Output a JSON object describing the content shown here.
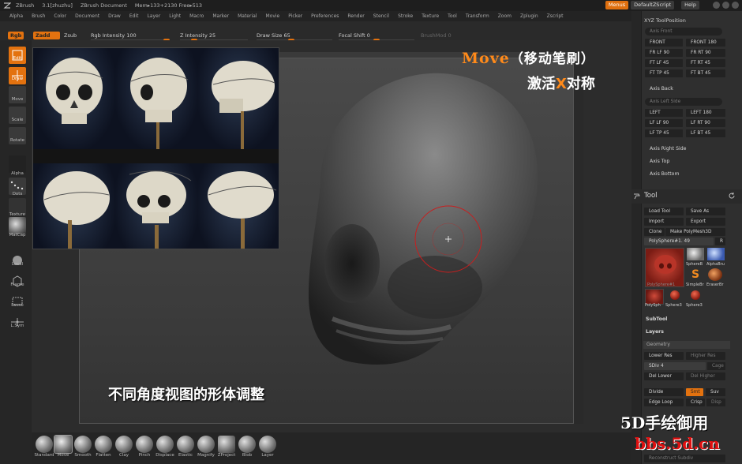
{
  "titlebar": {
    "app": "ZBrush",
    "version": "3.1[zhuzhu]",
    "doc": "ZBrush Document",
    "mem": "Mem▸133+2130 Free▸513",
    "menus_btn": "Menus",
    "script_btn": "DefaultZScript",
    "help_btn": "Help"
  },
  "menubar": [
    "Alpha",
    "Brush",
    "Color",
    "Document",
    "Draw",
    "Edit",
    "Layer",
    "Light",
    "Macro",
    "Marker",
    "Material",
    "Movie",
    "Picker",
    "Preferences",
    "Render",
    "Stencil",
    "Stroke",
    "Texture",
    "Tool",
    "Transform",
    "Zoom",
    "Zplugin",
    "Zscript"
  ],
  "toolbar": {
    "rgb": "Rgb",
    "zadd": "Zadd",
    "zsub": "Zsub",
    "rgb_intensity": "Rgb Intensity 100",
    "z_intensity": "Z Intensity 25",
    "draw_size": "Draw Size 65",
    "focal_shift": "Focal Shift 0",
    "brushmod": "BrushMod 0"
  },
  "left_tools": [
    "Edit",
    "Draw",
    "Move",
    "Scale",
    "Rotate",
    "Alpha",
    "Dots",
    "Texture",
    "MatCap",
    "Local",
    "Frame",
    "Lasso",
    "L.Sym"
  ],
  "overlay": {
    "move_title": "Move",
    "move_cn": "（移动笔刷）",
    "sym_pre": "激活",
    "sym_x": "X",
    "sym_post": "对称",
    "caption": "不同角度视图的形体调整"
  },
  "brushes": [
    "Standard",
    "Move",
    "Smooth",
    "Flatten",
    "Clay",
    "Pinch",
    "Displace",
    "Elastic",
    "Magnify",
    "ZProject",
    "Blob",
    "Layer"
  ],
  "xyz": {
    "header": "XYZ ToolPosition",
    "axis_front": "Axis Front",
    "front": "FRONT",
    "front180": "FRONT 180",
    "fr_lf90": "FR LF 90",
    "fr_rt90": "FR RT 90",
    "ft_lf45": "FT LF 45",
    "ft_rt45": "FT RT 45",
    "ft_tp45": "FT TP 45",
    "ft_bt45": "FT BT 45",
    "axis_back": "Axis Back",
    "axis_left_side": "Axis Left Side",
    "left": "LEFT",
    "left180": "LEFT 180",
    "lf_lf90": "LF LF 90",
    "lf_rt90": "LF RT 90",
    "lf_tp45": "LF TP 45",
    "lf_bt45": "LF BT 45",
    "axis_right_side": "Axis Right Side",
    "axis_top": "Axis Top",
    "axis_bottom": "Axis Bottom"
  },
  "tool": {
    "title": "Tool",
    "load_tool": "Load Tool",
    "save_as": "Save As",
    "import": "Import",
    "export": "Export",
    "clone": "Clone",
    "make_polymesh": "Make PolyMesh3D",
    "current": "PolySphere#1. 49",
    "r": "R",
    "thumbs": [
      "PolySphere#1",
      "SphereB",
      "AlphaBru",
      "SimpleBr",
      "EraserBr",
      "PolySph",
      "Sphere3",
      "Sphere3"
    ],
    "subtool": "SubTool",
    "layers": "Layers",
    "geometry": "Geometry",
    "lower_res": "Lower Res",
    "higher_res": "Higher Res",
    "sdiv": "SDiv 4",
    "cage": "Cage",
    "del_lower": "Del Lower",
    "del_higher": "Del Higher",
    "divide": "Divide",
    "smt": "Smt",
    "suv": "Suv",
    "edge_loop": "Edge Loop",
    "crisp": "Crisp",
    "disp": "Disp",
    "reconstruct": "Reconstruct Subdiv"
  },
  "watermark": {
    "line1": "5D手绘御用",
    "line2": "bbs.5d.cn"
  },
  "colors": {
    "accent": "#e3720f",
    "overlay_orange": "#ff8a1a",
    "watermark_red": "#e01010"
  }
}
